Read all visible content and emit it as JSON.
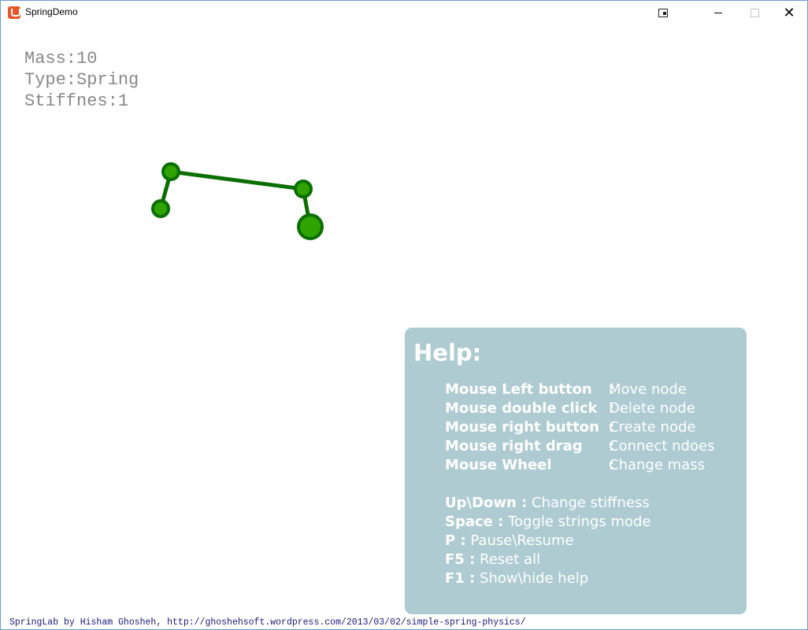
{
  "window": {
    "title": "SpringDemo",
    "controls": {
      "extra_icon": "window-extra-icon",
      "minimize_icon": "minimize-icon",
      "maximize_icon": "maximize-icon",
      "close_icon": "close-icon",
      "close_glyph": "✕"
    }
  },
  "info": {
    "mass": "Mass:10",
    "type": "Type:Spring",
    "stiffness": "Stiffnes:1"
  },
  "scene": {
    "node_fill": "#2fa300",
    "node_stroke": "#0b6e00",
    "spring_color": "#0b6e00"
  },
  "help": {
    "title": "Help:",
    "mouse_rows": [
      {
        "key": "Mouse Left button",
        "sep": ":",
        "desc": "Move node"
      },
      {
        "key": "Mouse double click",
        "sep": ":",
        "desc": "Delete node"
      },
      {
        "key": "Mouse right button",
        "sep": ":",
        "desc": "Create node"
      },
      {
        "key": "Mouse right drag",
        "sep": ":",
        "desc": "Connect ndoes"
      },
      {
        "key": "Mouse Wheel",
        "sep": ":",
        "desc": "Change mass"
      }
    ],
    "key_rows": [
      {
        "key": "Up\\Down :",
        "desc": "Change stiffness"
      },
      {
        "key": "Space :",
        "desc": "Toggle strings mode"
      },
      {
        "key": "P :",
        "desc": "Pause\\Resume"
      },
      {
        "key": "F5 :",
        "desc": "Reset all"
      },
      {
        "key": "F1 :",
        "desc": "Show\\hide help"
      }
    ]
  },
  "footer": "SpringLab by Hisham Ghosheh, http://ghoshehsoft.wordpress.com/2013/03/02/simple-spring-physics/"
}
